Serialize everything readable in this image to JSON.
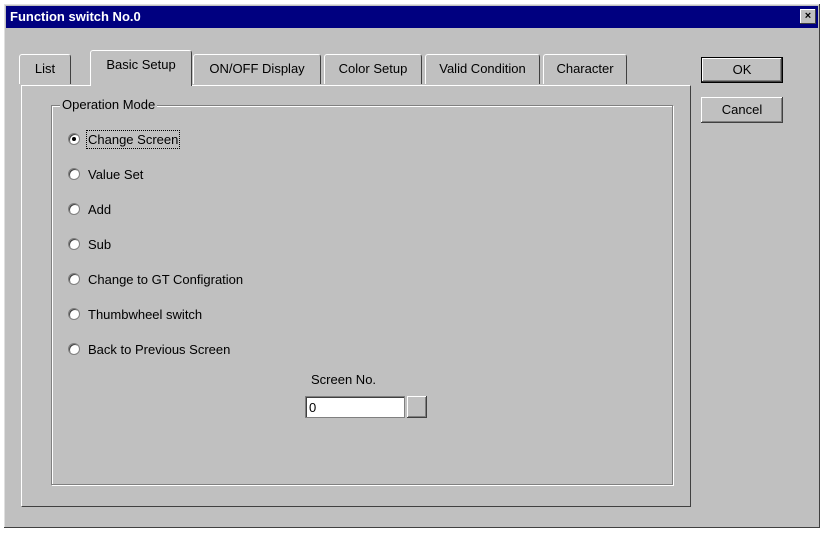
{
  "window": {
    "title": "Function switch No.0",
    "close_glyph": "×"
  },
  "tabs": [
    {
      "label": "List",
      "active": false
    },
    {
      "label": "Basic Setup",
      "active": true
    },
    {
      "label": "ON/OFF Display",
      "active": false
    },
    {
      "label": "Color Setup",
      "active": false
    },
    {
      "label": "Valid Condition",
      "active": false
    },
    {
      "label": "Character",
      "active": false
    }
  ],
  "operation_mode": {
    "label": "Operation Mode",
    "options": [
      {
        "label": "Change Screen",
        "checked": true
      },
      {
        "label": "Value Set",
        "checked": false
      },
      {
        "label": "Add",
        "checked": false
      },
      {
        "label": "Sub",
        "checked": false
      },
      {
        "label": "Change to GT Configration",
        "checked": false
      },
      {
        "label": "Thumbwheel switch",
        "checked": false
      },
      {
        "label": "Back to Previous Screen",
        "checked": false
      }
    ]
  },
  "screen_no": {
    "label": "Screen No.",
    "value": "0"
  },
  "buttons": {
    "ok": "OK",
    "cancel": "Cancel"
  }
}
